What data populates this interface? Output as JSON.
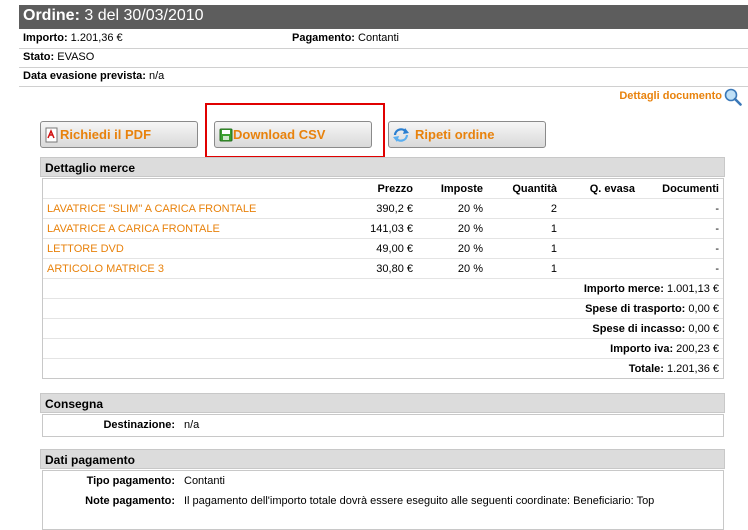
{
  "order": {
    "label": "Ordine:",
    "number": "3 del 30/03/2010",
    "importo_label": "Importo:",
    "importo": "1.201,36 €",
    "pagamento_label": "Pagamento:",
    "pagamento": "Contanti",
    "stato_label": "Stato:",
    "stato": "EVASO",
    "data_evasione_label": "Data evasione prevista:",
    "data_evasione": "n/a",
    "dettagli_link": "Dettagli documento"
  },
  "buttons": {
    "pdf": "Richiedi il PDF",
    "csv": "Download CSV",
    "repeat": "Ripeti ordine"
  },
  "merce": {
    "title": "Dettaglio merce",
    "columns": [
      "",
      "Prezzo",
      "Imposte",
      "Quantità",
      "Q. evasa",
      "Documenti"
    ],
    "rows": [
      {
        "name": "LAVATRICE \"SLIM\" A CARICA FRONTALE",
        "prezzo": "390,2 €",
        "imposte": "20 %",
        "quantita": "2",
        "evasa": "",
        "documenti": "-"
      },
      {
        "name": "LAVATRICE A CARICA FRONTALE",
        "prezzo": "141,03 €",
        "imposte": "20 %",
        "quantita": "1",
        "evasa": "",
        "documenti": "-"
      },
      {
        "name": "LETTORE DVD",
        "prezzo": "49,00 €",
        "imposte": "20 %",
        "quantita": "1",
        "evasa": "",
        "documenti": "-"
      },
      {
        "name": "ARTICOLO MATRICE 3",
        "prezzo": "30,80 €",
        "imposte": "20 %",
        "quantita": "1",
        "evasa": "",
        "documenti": "-"
      }
    ],
    "totals": [
      {
        "label": "Importo merce:",
        "value": "1.001,13 €"
      },
      {
        "label": "Spese di trasporto:",
        "value": "0,00 €"
      },
      {
        "label": "Spese di incasso:",
        "value": "0,00 €"
      },
      {
        "label": "Importo iva:",
        "value": "200,23 €"
      },
      {
        "label": "Totale:",
        "value": "1.201,36 €"
      }
    ]
  },
  "consegna": {
    "title": "Consegna",
    "destinazione_label": "Destinazione:",
    "destinazione": "n/a"
  },
  "pagamento": {
    "title": "Dati pagamento",
    "tipo_label": "Tipo pagamento:",
    "tipo": "Contanti",
    "note_label": "Note pagamento:",
    "note": "Il pagamento dell'importo totale dovrà essere eseguito alle seguenti coordinate: Beneficiario: Top"
  },
  "colors": {
    "accent": "#e8820c",
    "header_bg": "#5d5d5d",
    "highlight": "#e00000"
  }
}
